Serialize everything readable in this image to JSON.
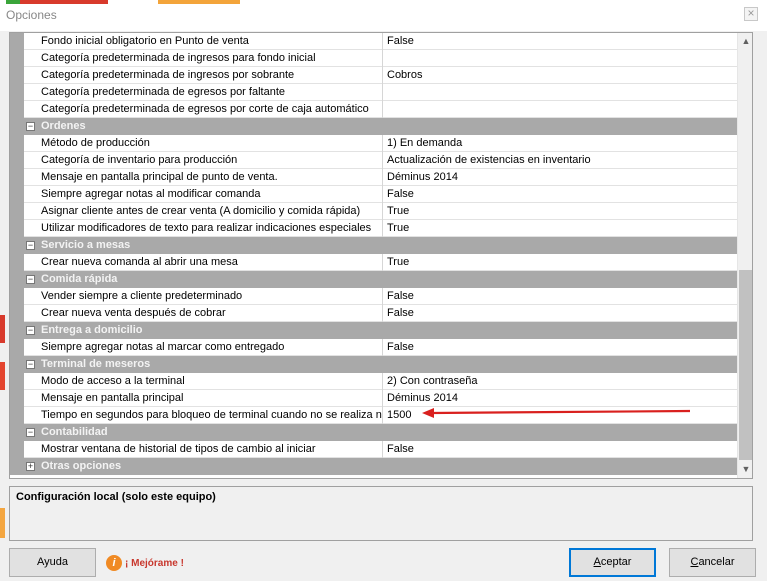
{
  "window": {
    "title": "Opciones",
    "close_glyph": "×"
  },
  "accent": {
    "arrow": "#d9201e",
    "category_bg": "#a9a9a9",
    "focus": "#0078d7"
  },
  "grid": {
    "rows": [
      {
        "type": "prop",
        "name": "Fondo inicial obligatorio en Punto de venta",
        "value": "False"
      },
      {
        "type": "prop",
        "name": "Categoría predeterminada de ingresos para fondo inicial",
        "value": ""
      },
      {
        "type": "prop",
        "name": "Categoría predeterminada de ingresos por sobrante",
        "value": "Cobros"
      },
      {
        "type": "prop",
        "name": "Categoría predeterminada de egresos por faltante",
        "value": ""
      },
      {
        "type": "prop",
        "name": "Categoría predeterminada de egresos por corte de caja automático",
        "value": ""
      },
      {
        "type": "cat",
        "name": "Ordenes",
        "toggle": "−"
      },
      {
        "type": "prop",
        "name": "Método de producción",
        "value": "1) En demanda"
      },
      {
        "type": "prop",
        "name": "Categoría de inventario para producción",
        "value": "Actualización de existencias en inventario"
      },
      {
        "type": "prop",
        "name": "Mensaje en pantalla principal de punto de venta.",
        "value": "Déminus 2014"
      },
      {
        "type": "prop",
        "name": "Siempre agregar notas al modificar comanda",
        "value": "False"
      },
      {
        "type": "prop",
        "name": "Asignar cliente antes de crear venta (A domicilio y comida rápida)",
        "value": "True"
      },
      {
        "type": "prop",
        "name": "Utilizar modificadores de texto para realizar indicaciones especiales",
        "value": "True"
      },
      {
        "type": "cat",
        "name": "Servicio a mesas",
        "toggle": "−"
      },
      {
        "type": "prop",
        "name": "Crear nueva comanda al abrir una mesa",
        "value": "True"
      },
      {
        "type": "cat",
        "name": "Comida rápida",
        "toggle": "−"
      },
      {
        "type": "prop",
        "name": "Vender siempre a cliente predeterminado",
        "value": "False"
      },
      {
        "type": "prop",
        "name": "Crear nueva venta después de cobrar",
        "value": "False"
      },
      {
        "type": "cat",
        "name": "Entrega a domicilio",
        "toggle": "−"
      },
      {
        "type": "prop",
        "name": "Siempre agregar notas al marcar como entregado",
        "value": "False"
      },
      {
        "type": "cat",
        "name": "Terminal de meseros",
        "toggle": "−"
      },
      {
        "type": "prop",
        "name": "Modo de acceso a la terminal",
        "value": "2) Con contraseña"
      },
      {
        "type": "prop",
        "name": "Mensaje en pantalla principal",
        "value": "Déminus 2014"
      },
      {
        "type": "prop",
        "name": "Tiempo en segundos para bloqueo de terminal cuando no se realiza ning",
        "value": "1500"
      },
      {
        "type": "cat",
        "name": "Contabilidad",
        "toggle": "−"
      },
      {
        "type": "prop",
        "name": "Mostrar ventana de historial de tipos de cambio al iniciar",
        "value": "False"
      },
      {
        "type": "cat",
        "name": "Otras opciones",
        "toggle": "+"
      }
    ]
  },
  "description": {
    "title": "Configuración local (solo este equipo)"
  },
  "buttons": {
    "help": "Ayuda",
    "improve_icon_letter": "i",
    "improve": "¡ Mejórame !",
    "accept_first": "A",
    "accept_rest": "ceptar",
    "cancel_first": "C",
    "cancel_rest": "ancelar"
  }
}
